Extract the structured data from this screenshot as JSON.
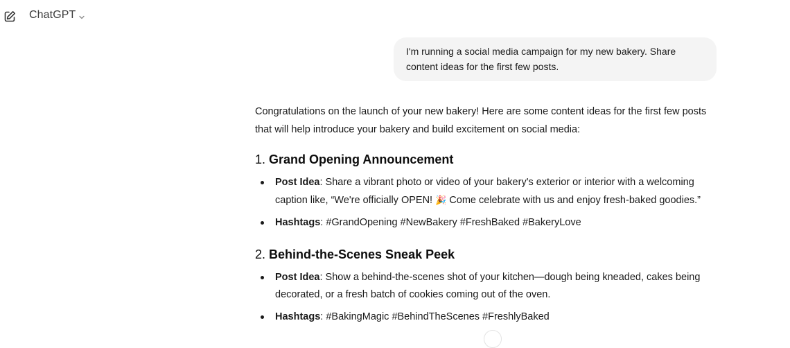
{
  "header": {
    "model_name": "ChatGPT",
    "new_chat_icon": "edit-icon",
    "dropdown_icon": "chevron-down-icon"
  },
  "conversation": {
    "user_message": "I'm running a social media campaign for my new bakery. Share content ideas for the first few posts.",
    "assistant": {
      "intro": "Congratulations on the launch of your new bakery! Here are some content ideas for the first few posts that will help introduce your bakery and build excitement on social media:",
      "sections": [
        {
          "number": "1.",
          "title": "Grand Opening Announcement",
          "post_idea_label": "Post Idea",
          "post_idea_text_a": ": Share a vibrant photo or video of your bakery's exterior or interior with a welcoming caption like, “We're officially OPEN! ",
          "post_idea_emoji": "🎉",
          "post_idea_text_b": " Come celebrate with us and enjoy fresh-baked goodies.”",
          "hashtags_label": "Hashtags",
          "hashtags_text": ": #GrandOpening #NewBakery #FreshBaked #BakeryLove"
        },
        {
          "number": "2.",
          "title": "Behind-the-Scenes Sneak Peek",
          "post_idea_label": "Post Idea",
          "post_idea_text": ": Show a behind-the-scenes shot of your kitchen—dough being kneaded, cakes being decorated, or a fresh batch of cookies coming out of the oven.",
          "hashtags_label": "Hashtags",
          "hashtags_text": ": #BakingMagic #BehindTheScenes #FreshlyBaked"
        }
      ]
    }
  },
  "colors": {
    "user_bubble_bg": "#f4f4f4",
    "text": "#1a1a1a"
  }
}
